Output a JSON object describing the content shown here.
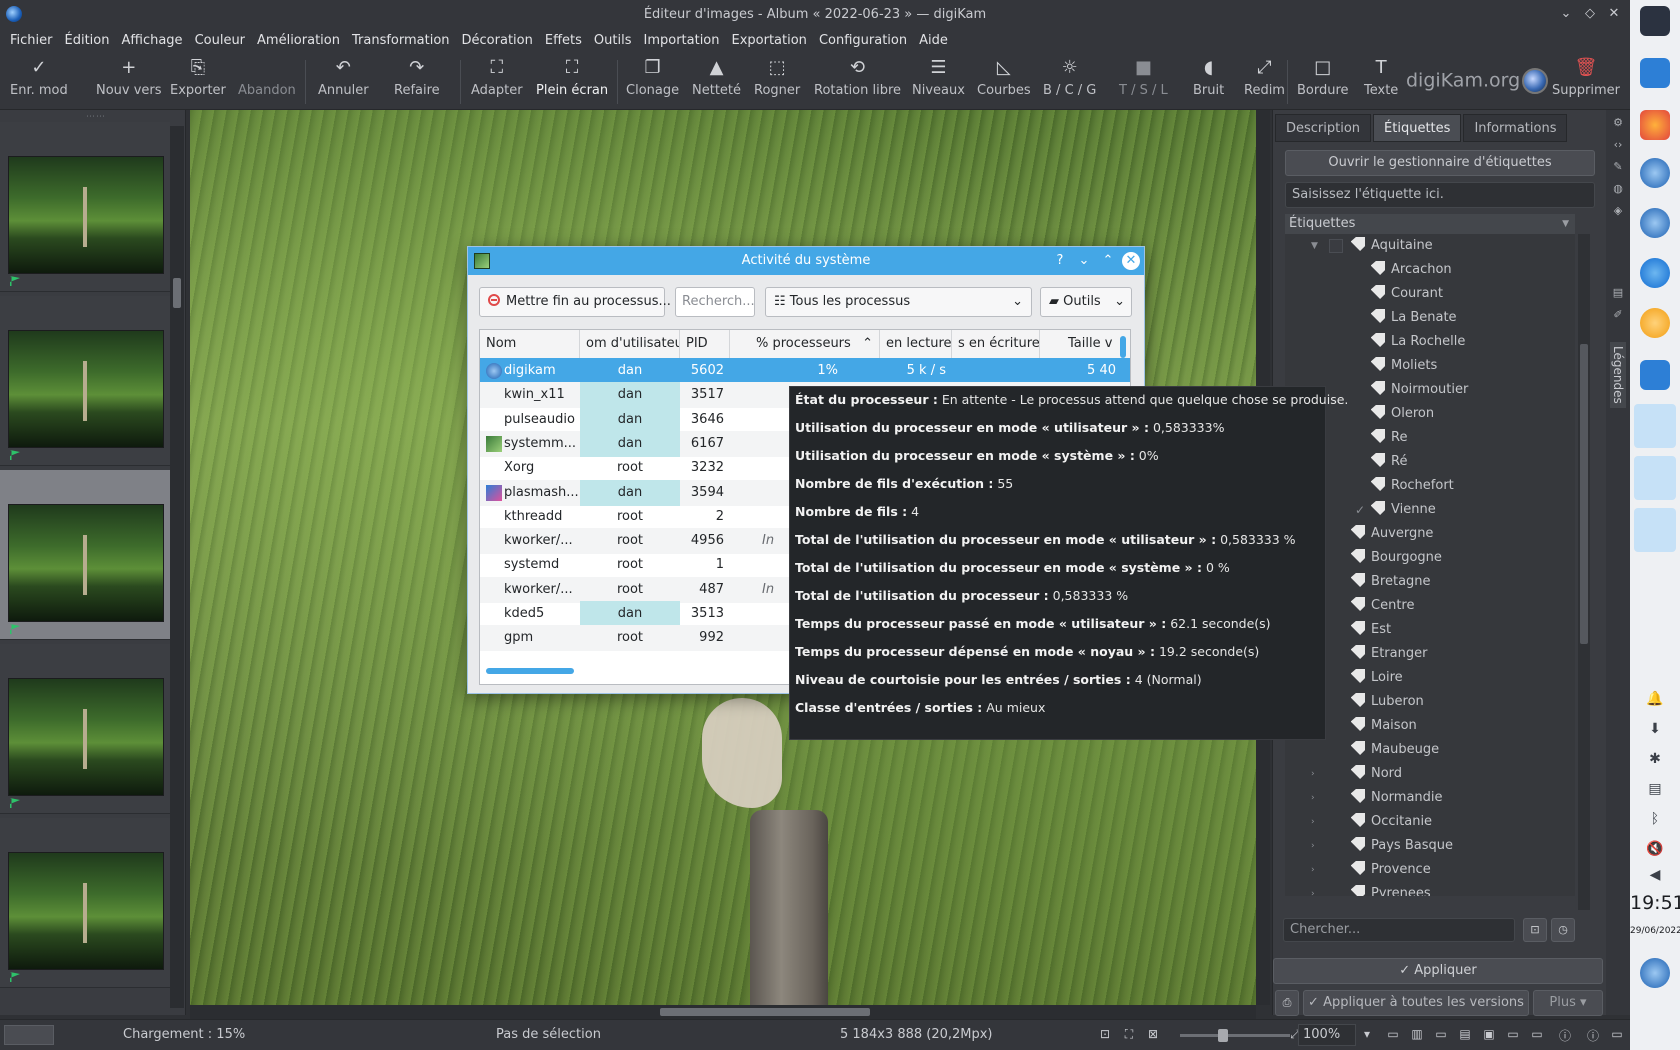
{
  "window": {
    "title": "Éditeur d'images - Album « 2022-06-23 » — digiKam",
    "logo_text": "digiKam.org"
  },
  "menu": [
    "Fichier",
    "Édition",
    "Affichage",
    "Couleur",
    "Amélioration",
    "Transformation",
    "Décoration",
    "Effets",
    "Outils",
    "Importation",
    "Exportation",
    "Configuration",
    "Aide"
  ],
  "toolbar": {
    "save": "Enr. mod",
    "new_version": "Nouv vers",
    "export": "Exporter",
    "abort": "Abandon",
    "undo": "Annuler",
    "redo": "Refaire",
    "fit": "Adapter",
    "fullscreen": "Plein écran",
    "clone": "Clonage",
    "sharpen": "Netteté",
    "crop": "Rogner",
    "free_rotation": "Rotation libre",
    "levels": "Niveaux",
    "curves": "Courbes",
    "bcg": "B / C / G",
    "hsl": "T / S / L",
    "noise": "Bruit",
    "resize": "Redim",
    "border": "Bordure",
    "text": "Texte",
    "delete": "Supprimer"
  },
  "right_panel": {
    "tabs": [
      "Description",
      "Étiquettes",
      "Informations"
    ],
    "active_tab": "Étiquettes",
    "tag_manager_button": "Ouvrir le gestionnaire d'étiquettes",
    "tag_input_placeholder": "Saisissez l'étiquette ici.",
    "tree_header": "Étiquettes",
    "tree": [
      {
        "label": "Aquitaine",
        "level": 1,
        "expanded": true
      },
      {
        "label": "Arcachon",
        "level": 2
      },
      {
        "label": "Courant",
        "level": 2
      },
      {
        "label": "La Benate",
        "level": 2
      },
      {
        "label": "La Rochelle",
        "level": 2
      },
      {
        "label": "Moliets",
        "level": 2
      },
      {
        "label": "Noirmoutier",
        "level": 2
      },
      {
        "label": "Oleron",
        "level": 2
      },
      {
        "label": "Re",
        "level": 2
      },
      {
        "label": "Ré",
        "level": 2
      },
      {
        "label": "Rochefort",
        "level": 2
      },
      {
        "label": "Vienne",
        "level": 2,
        "checked": true
      },
      {
        "label": "Auvergne",
        "level": 1
      },
      {
        "label": "Bourgogne",
        "level": 1
      },
      {
        "label": "Bretagne",
        "level": 1
      },
      {
        "label": "Centre",
        "level": 1
      },
      {
        "label": "Est",
        "level": 1
      },
      {
        "label": "Etranger",
        "level": 1
      },
      {
        "label": "Loire",
        "level": 1
      },
      {
        "label": "Luberon",
        "level": 1
      },
      {
        "label": "Maison",
        "level": 1
      },
      {
        "label": "Maubeuge",
        "level": 1
      },
      {
        "label": "Nord",
        "level": 1,
        "collapsed": true
      },
      {
        "label": "Normandie",
        "level": 1,
        "collapsed": true
      },
      {
        "label": "Occitanie",
        "level": 1,
        "collapsed": true
      },
      {
        "label": "Pays Basque",
        "level": 1,
        "collapsed": true
      },
      {
        "label": "Provence",
        "level": 1,
        "collapsed": true
      },
      {
        "label": "Pyrenees",
        "level": 1,
        "collapsed": true
      }
    ],
    "search_placeholder": "Chercher...",
    "apply_button": "Appliquer",
    "apply_all_button": "Appliquer à toutes les versions",
    "more_button": "Plus",
    "side_tab_label": "Légendes"
  },
  "status": {
    "loading": "Chargement : 15%",
    "selection": "Pas de sélection",
    "dimensions": "5 184x3 888 (20,2Mpx)",
    "zoom": "100%"
  },
  "taskbar": {
    "time": "19:51",
    "date": "29/06/2022"
  },
  "dialog": {
    "title": "Activité du système",
    "kill_button": "Mettre fin au processus...",
    "search_placeholder": "Recherch...",
    "filter_value": "Tous les processus",
    "tools_button": "Outils",
    "columns": [
      "Nom",
      "om d'utilisateu",
      "PID",
      "% processeurs",
      "en lecture",
      "s en écriture",
      "Taille v"
    ],
    "rows": [
      {
        "name": "digikam",
        "user": "dan",
        "pid": "5602",
        "cpu": "1%",
        "read": "5 k / s",
        "size": "5 40"
      },
      {
        "name": "kwin_x11",
        "user": "dan",
        "pid": "3517"
      },
      {
        "name": "pulseaudio",
        "user": "dan",
        "pid": "3646"
      },
      {
        "name": "systemm...",
        "user": "dan",
        "pid": "6167"
      },
      {
        "name": "Xorg",
        "user": "root",
        "pid": "3232"
      },
      {
        "name": "plasmash...",
        "user": "dan",
        "pid": "3594"
      },
      {
        "name": "kthreadd",
        "user": "root",
        "pid": "2"
      },
      {
        "name": "kworker/...",
        "user": "root",
        "pid": "4956",
        "extra": "In"
      },
      {
        "name": "systemd",
        "user": "root",
        "pid": "1"
      },
      {
        "name": "kworker/...",
        "user": "root",
        "pid": "487",
        "extra": "In"
      },
      {
        "name": "kded5",
        "user": "dan",
        "pid": "3513"
      },
      {
        "name": "gpm",
        "user": "root",
        "pid": "992"
      }
    ]
  },
  "tooltip": [
    {
      "label": "État du processeur :",
      "value": " En attente - Le processus attend que quelque chose se produise."
    },
    {
      "label": "Utilisation du processeur en mode « utilisateur » :",
      "value": " 0,583333%"
    },
    {
      "label": "Utilisation du processeur en mode « système » :",
      "value": " 0%"
    },
    {
      "label": "Nombre de fils d'exécution :",
      "value": " 55"
    },
    {
      "label": "Nombre de fils :",
      "value": " 4"
    },
    {
      "label": "Total de l'utilisation du processeur en mode « utilisateur » :",
      "value": " 0,583333 %"
    },
    {
      "label": "Total de l'utilisation du processeur en mode « système » :",
      "value": " 0 %"
    },
    {
      "label": "Total de l'utilisation du processeur :",
      "value": " 0,583333 %"
    },
    {
      "label": "Temps du processeur passé en mode « utilisateur » :",
      "value": " 62.1 seconde(s)"
    },
    {
      "label": "Temps du processeur dépensé en mode « noyau » :",
      "value": " 19.2 seconde(s)"
    },
    {
      "label": "Niveau de courtoisie pour les entrées / sorties :",
      "value": " 4 (Normal)"
    },
    {
      "label": "Classe d'entrées / sorties :",
      "value": " Au mieux"
    }
  ]
}
